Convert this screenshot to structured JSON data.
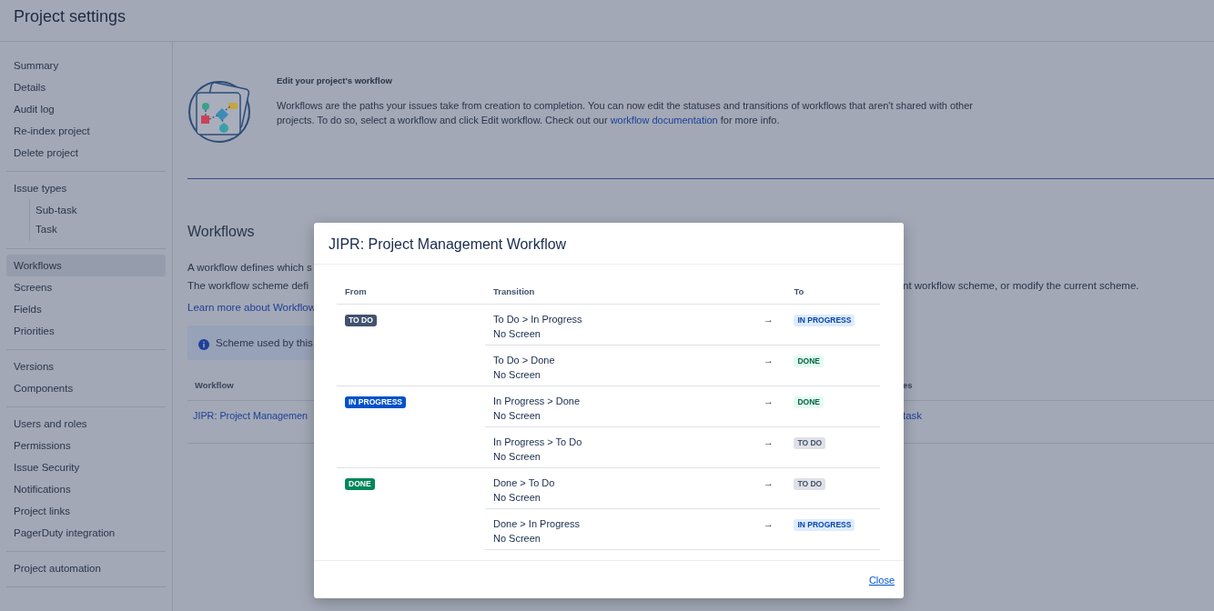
{
  "header": {
    "title": "Project settings"
  },
  "sidebar": {
    "groups": [
      {
        "items": [
          {
            "label": "Summary",
            "selected": false
          },
          {
            "label": "Details",
            "selected": false
          },
          {
            "label": "Audit log",
            "selected": false
          },
          {
            "label": "Re-index project",
            "selected": false
          },
          {
            "label": "Delete project",
            "selected": false
          }
        ]
      },
      {
        "items": [
          {
            "label": "Issue types",
            "selected": false,
            "children": [
              {
                "label": "Sub-task",
                "selected": false
              },
              {
                "label": "Task",
                "selected": false
              }
            ]
          }
        ]
      },
      {
        "items": [
          {
            "label": "Workflows",
            "selected": true
          },
          {
            "label": "Screens",
            "selected": false
          },
          {
            "label": "Fields",
            "selected": false
          },
          {
            "label": "Priorities",
            "selected": false
          }
        ]
      },
      {
        "items": [
          {
            "label": "Versions",
            "selected": false
          },
          {
            "label": "Components",
            "selected": false
          }
        ]
      },
      {
        "items": [
          {
            "label": "Users and roles",
            "selected": false
          },
          {
            "label": "Permissions",
            "selected": false
          },
          {
            "label": "Issue Security",
            "selected": false
          },
          {
            "label": "Notifications",
            "selected": false
          },
          {
            "label": "Project links",
            "selected": false
          },
          {
            "label": "PagerDuty integration",
            "selected": false
          }
        ]
      },
      {
        "items": [
          {
            "label": "Project automation",
            "selected": false
          }
        ]
      }
    ]
  },
  "intro": {
    "heading": "Edit your project's workflow",
    "text": "Workflows are the paths your issues take from creation to completion. You can now edit the statuses and transitions of workflows that aren't shared with other projects. To do so, select a workflow and click Edit workflow. Check out our ",
    "link": "workflow documentation",
    "text_end": " for more info."
  },
  "workflows": {
    "title": "Workflows",
    "line_1": "A workflow defines which s",
    "line_2": {
      "start": "The workflow scheme defi",
      "end": "nt workflow scheme, or modify the current scheme."
    },
    "link": "Learn more about Workflow",
    "notice": "Scheme used by this",
    "table": {
      "columns": [
        "Workflow",
        "es"
      ],
      "rows": [
        {
          "cells": [
            "JIPR: Project Managemen",
            "task"
          ]
        }
      ]
    }
  },
  "dialog": {
    "title": "JIPR: Project Management Workflow",
    "columns": [
      "From",
      "Transition",
      "To"
    ],
    "groups": [
      {
        "from": {
          "label": "TO DO",
          "kind": "todo"
        },
        "transitions": [
          {
            "name": "To Do > In Progress",
            "screen": "No Screen",
            "arrow": "→",
            "to": {
              "label": "IN PROGRESS",
              "kind": "inprogress"
            }
          },
          {
            "name": "To Do > Done",
            "screen": "No Screen",
            "arrow": "→",
            "to": {
              "label": "DONE",
              "kind": "done"
            }
          }
        ]
      },
      {
        "from": {
          "label": "IN PROGRESS",
          "kind": "inprogress"
        },
        "transitions": [
          {
            "name": "In Progress > Done",
            "screen": "No Screen",
            "arrow": "→",
            "to": {
              "label": "DONE",
              "kind": "done"
            }
          },
          {
            "name": "In Progress > To Do",
            "screen": "No Screen",
            "arrow": "→",
            "to": {
              "label": "TO DO",
              "kind": "todo"
            }
          }
        ]
      },
      {
        "from": {
          "label": "DONE",
          "kind": "done"
        },
        "transitions": [
          {
            "name": "Done > To Do",
            "screen": "No Screen",
            "arrow": "→",
            "to": {
              "label": "TO DO",
              "kind": "todo"
            }
          },
          {
            "name": "Done > In Progress",
            "screen": "No Screen",
            "arrow": "→",
            "to": {
              "label": "IN PROGRESS",
              "kind": "inprogress"
            }
          }
        ]
      }
    ],
    "close": "Close"
  }
}
